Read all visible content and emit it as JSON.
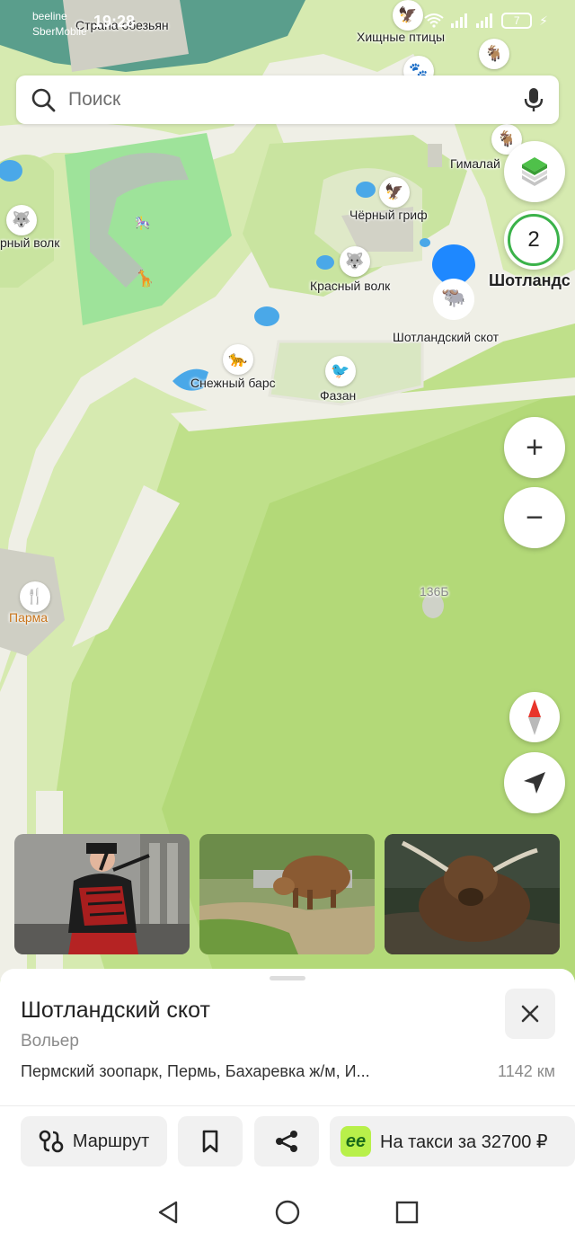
{
  "status_bar": {
    "carrier1": "beeline",
    "carrier2": "SberMobile",
    "time": "19:28",
    "battery": "7"
  },
  "search": {
    "placeholder": "Поиск"
  },
  "map": {
    "labels": {
      "top_left": "Страна обезьян",
      "birds_of_prey": "Хищные птицы",
      "himalayan": "Гималай",
      "black_vulture": "Чёрный гриф",
      "wolf": "рный волк",
      "red_wolf": "Красный волк",
      "scottish_cattle_short": "Шотландс",
      "scottish_cattle": "Шотландский скот",
      "snow_leopard": "Снежный барс",
      "pheasant": "Фазан",
      "parma": "Парма",
      "building": "136Б"
    },
    "cluster_count": "2",
    "colors": {
      "grass": "#d6eab0",
      "path": "#f2f2ea",
      "water": "#4aa8e8",
      "marker": "#1e88ff"
    }
  },
  "controls": {
    "zoom_in": "+",
    "zoom_out": "−",
    "icons": [
      "layers-icon",
      "compass-icon",
      "my-location-icon"
    ]
  },
  "place": {
    "title": "Шотландский скот",
    "category": "Вольер",
    "address": "Пермский зоопарк, Пермь, Бахаревка ж/м, И...",
    "distance": "1142 км"
  },
  "actions": {
    "route": "Маршрут",
    "taxi": "На такси за 32700 ₽"
  }
}
